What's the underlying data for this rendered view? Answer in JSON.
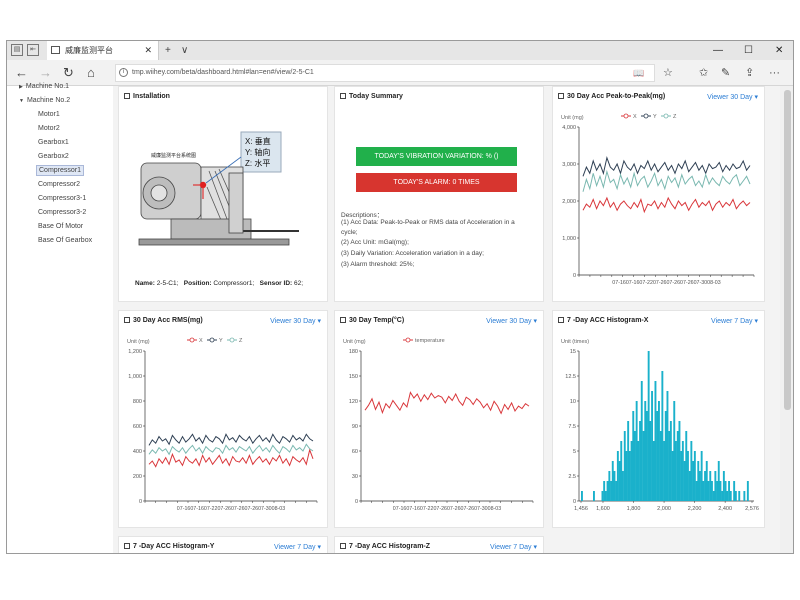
{
  "browser": {
    "tab_title": "威廉监测平台",
    "tab_close": "✕",
    "new_tab": "+",
    "tab_menu": "∨",
    "min": "—",
    "max": "☐",
    "close": "✕",
    "url": "tmp.wiihey.com/beta/dashboard.html#lan=en#/view/2-5-C1",
    "nav": {
      "back": "←",
      "forward": "→",
      "refresh": "↻",
      "home": "⌂"
    },
    "icons": {
      "reader": "📖",
      "favorite": "☆",
      "favorites_list": "✩",
      "notes": "✎",
      "share": "⇪",
      "more": "···"
    }
  },
  "sidebar": {
    "machines": [
      "Machine No.1",
      "Machine No.2"
    ],
    "items": [
      "Motor1",
      "Motor2",
      "Gearbox1",
      "Gearbox2",
      "Compressor1",
      "Compressor2",
      "Compressor3-1",
      "Compressor3-2",
      "Base Of Motor",
      "Base Of Gearbox"
    ],
    "selected": "Compressor1"
  },
  "installation": {
    "title": "Installation",
    "diagram_header": "威廉监测平台系统图",
    "axes": [
      "X: 垂直",
      "Y: 轴向",
      "Z: 水平"
    ],
    "name_label": "Name:",
    "name_value": "2-5-C1;",
    "position_label": "Position:",
    "position_value": "Compressor1;",
    "sensor_label": "Sensor ID:",
    "sensor_value": "62;"
  },
  "summary": {
    "title": "Today Summary",
    "variation_btn": "TODAY'S VIBRATION VARIATION: % ()",
    "alarm_btn": "TODAY'S ALARM: 0 TIMES",
    "desc_title": "Descriptions：",
    "lines": [
      "(1) Acc Data: Peak-to-Peak or RMS data of Acceleration in a",
      "cycle;",
      "(2) Acc Unit: mGal(mg);",
      "(3) Daily Variation: Acceleration variation in a day;",
      "(3) Alarm threshold: 25%;"
    ]
  },
  "colors": {
    "x": "#d9373b",
    "y": "#2f4054",
    "z": "#7ab8b0",
    "temp": "#d9373b",
    "bar": "#1ab1cb",
    "link": "#2b7dd4"
  },
  "chart_data": [
    {
      "type": "line",
      "title": "30 Day Acc Peak-to-Peak(mg)",
      "viewer": "Viewer 30 Day",
      "unit": "Unit (mg)",
      "y_ticks": [
        "4,000",
        "3,000",
        "2,000",
        "1,000",
        "0"
      ],
      "ylim": [
        0,
        4800
      ],
      "x_ticks": "07-1607-1607-2207-2607-2607-2607-3008-03",
      "series": [
        {
          "name": "X",
          "values": [
            2100,
            2300,
            2200,
            2450,
            2150,
            2400,
            2250,
            2500,
            2200,
            2350,
            2100,
            2300,
            2400,
            2250,
            2150,
            2350,
            2200,
            2450,
            2050,
            2300,
            2250,
            2400,
            2150,
            2350,
            2200,
            2500,
            2300,
            2150,
            2400,
            2250,
            2350,
            2100,
            2300,
            2450,
            2200,
            2350,
            2250,
            2400,
            2100,
            2300,
            2400,
            2200,
            2350,
            2250,
            2450,
            2150,
            2300,
            2400,
            2250,
            2350
          ]
        },
        {
          "name": "Y",
          "values": [
            3200,
            3500,
            3300,
            3700,
            3400,
            3600,
            3300,
            3800,
            3500,
            3400,
            3600,
            3300,
            3700,
            3500,
            3400,
            3600,
            3300,
            3550,
            3450,
            3700,
            3400,
            3600,
            3350,
            3500,
            3650,
            3400,
            3550,
            3300,
            3600,
            3450,
            3700,
            3350,
            3500,
            3650,
            3400,
            3550,
            3300,
            3600,
            3450,
            3500,
            3650,
            3350,
            3550,
            3400,
            3600,
            3450,
            3500,
            3700,
            3400,
            3550
          ]
        },
        {
          "name": "Z",
          "values": [
            2700,
            3100,
            2800,
            3300,
            2900,
            3200,
            2850,
            3350,
            3000,
            3100,
            2800,
            3250,
            2950,
            3150,
            2850,
            3300,
            2900,
            3100,
            3200,
            2850,
            3050,
            3300,
            2900,
            3100,
            2800,
            3200,
            3000,
            3150,
            2850,
            3250,
            2950,
            3100,
            3200,
            2900,
            3050,
            2850,
            3250,
            2950,
            3150,
            3000,
            2900,
            3200,
            3050,
            2950,
            3150,
            3250,
            2900,
            3050,
            3200,
            2950
          ]
        }
      ]
    },
    {
      "type": "line",
      "title": "30 Day Acc RMS(mg)",
      "viewer": "Viewer 30 Day",
      "unit": "Unit (mg)",
      "y_ticks": [
        "1,200",
        "1,000",
        "800",
        "600",
        "400",
        "200",
        "0"
      ],
      "ylim": [
        0,
        1350
      ],
      "x_ticks": "07-1607-1607-2207-2607-2607-2607-3008-03",
      "series": [
        {
          "name": "X",
          "values": [
            330,
            360,
            310,
            380,
            340,
            390,
            330,
            420,
            350,
            370,
            320,
            400,
            360,
            340,
            380,
            320,
            410,
            350,
            390,
            330,
            370,
            410,
            340,
            380,
            320,
            400,
            360,
            350,
            390,
            340,
            410,
            330,
            370,
            400,
            350,
            380,
            330,
            390,
            360,
            410,
            340,
            380,
            320,
            400,
            370,
            350,
            390,
            330,
            460,
            380
          ]
        },
        {
          "name": "Y",
          "values": [
            500,
            550,
            520,
            580,
            540,
            560,
            510,
            590,
            550,
            520,
            580,
            530,
            560,
            600,
            540,
            570,
            520,
            590,
            550,
            530,
            580,
            560,
            520,
            600,
            550,
            570,
            530,
            590,
            560,
            540,
            580,
            520,
            560,
            590,
            540,
            570,
            530,
            600,
            550,
            520,
            580,
            560,
            530,
            590,
            550,
            570,
            540,
            600,
            560,
            540
          ]
        },
        {
          "name": "Z",
          "values": [
            420,
            460,
            430,
            480,
            450,
            470,
            420,
            490,
            460,
            440,
            480,
            430,
            470,
            500,
            450,
            480,
            430,
            490,
            460,
            440,
            480,
            470,
            430,
            500,
            460,
            480,
            440,
            490,
            470,
            450,
            490,
            430,
            470,
            500,
            450,
            480,
            440,
            500,
            460,
            430,
            490,
            470,
            440,
            500,
            460,
            480,
            450,
            510,
            470,
            450
          ]
        }
      ]
    },
    {
      "type": "line",
      "title": "30 Day Temp(°C)",
      "viewer": "Viewer 30 Day",
      "unit": "Unit (mg)",
      "y_ticks": [
        "180",
        "150",
        "120",
        "90",
        "60",
        "30",
        "0"
      ],
      "ylim": [
        0,
        185
      ],
      "x_ticks": "07-1607-1607-2207-2607-2607-2607-3008-03",
      "series": [
        {
          "name": "temperature",
          "values": [
            112,
            118,
            126,
            113,
            122,
            109,
            120,
            115,
            124,
            118,
            112,
            121,
            116,
            134,
            127,
            132,
            123,
            131,
            125,
            133,
            127,
            130,
            128,
            121,
            129,
            124,
            132,
            123,
            118,
            128,
            125,
            119,
            126,
            122,
            115,
            120,
            112,
            123,
            117,
            108,
            119,
            113,
            121,
            111,
            117,
            114,
            120,
            117
          ]
        }
      ]
    },
    {
      "type": "bar",
      "title": "7 -Day ACC Histogram-X",
      "viewer": "Viewer 7 Day",
      "unit": "Unit (times)",
      "y_ticks": [
        "15",
        "12.5",
        "10",
        "7.5",
        "5",
        "2.5",
        "0"
      ],
      "ylim": [
        0,
        15
      ],
      "x_ticks": [
        "1,456",
        "1,600",
        "1,800",
        "2,000",
        "2,200",
        "2,400",
        "2,576"
      ],
      "xlim": [
        1456,
        2576
      ],
      "values": [
        1,
        0,
        0,
        0,
        0,
        0,
        0,
        1,
        0,
        0,
        0,
        0,
        1,
        2,
        1,
        2,
        3,
        2,
        4,
        3,
        2,
        5,
        4,
        6,
        3,
        7,
        5,
        8,
        5,
        6,
        9,
        7,
        10,
        6,
        8,
        12,
        7,
        10,
        9,
        15,
        8,
        11,
        6,
        12,
        9,
        10,
        7,
        13,
        6,
        9,
        11,
        7,
        8,
        5,
        10,
        6,
        7,
        8,
        5,
        6,
        4,
        7,
        5,
        3,
        6,
        4,
        5,
        2,
        4,
        3,
        5,
        2,
        3,
        4,
        2,
        3,
        2,
        1,
        3,
        2,
        4,
        2,
        1,
        3,
        2,
        1,
        2,
        1,
        0,
        2,
        1,
        0,
        1,
        0,
        0,
        1,
        0,
        2,
        0,
        0
      ]
    }
  ],
  "bottom_panels": [
    {
      "title": "7 -Day ACC Histogram-Y",
      "viewer": "Viewer 7 Day"
    },
    {
      "title": "7 -Day ACC Histogram-Z",
      "viewer": "Viewer 7 Day"
    }
  ]
}
